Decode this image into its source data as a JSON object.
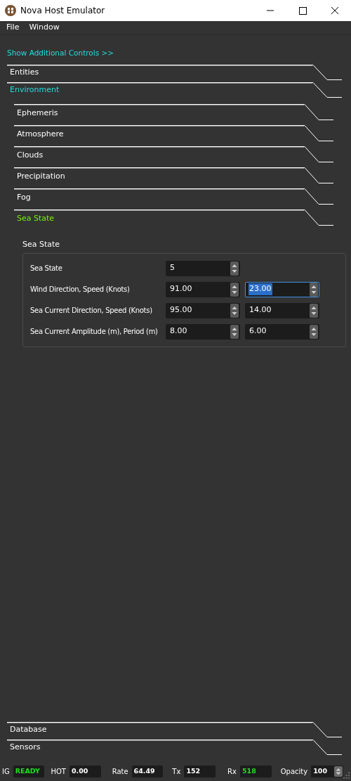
{
  "window": {
    "title": "Nova Host Emulator"
  },
  "menu": [
    "File",
    "Window"
  ],
  "link": "Show Additional Controls >>",
  "sections": [
    {
      "label": "Entities",
      "expanded": false
    },
    {
      "label": "Environment",
      "expanded": true,
      "children": [
        {
          "label": "Ephemeris",
          "expanded": false
        },
        {
          "label": "Atmosphere",
          "expanded": false
        },
        {
          "label": "Clouds",
          "expanded": false
        },
        {
          "label": "Precipitation",
          "expanded": false
        },
        {
          "label": "Fog",
          "expanded": false
        },
        {
          "label": "Sea State",
          "expanded": true,
          "group": {
            "title": "Sea State",
            "rows": [
              {
                "label": "Sea State",
                "fields": [
                  {
                    "value": "5",
                    "focused": false
                  }
                ]
              },
              {
                "label": "Wind Direction, Speed (Knots)",
                "fields": [
                  {
                    "value": "91.00",
                    "focused": false
                  },
                  {
                    "value": "23.00",
                    "focused": true
                  }
                ]
              },
              {
                "label": "Sea Current Direction, Speed (Knots)",
                "fields": [
                  {
                    "value": "95.00",
                    "focused": false
                  },
                  {
                    "value": "14.00",
                    "focused": false
                  }
                ]
              },
              {
                "label": "Sea Current Amplitude (m), Period (m)",
                "fields": [
                  {
                    "value": "8.00",
                    "focused": false
                  },
                  {
                    "value": "6.00",
                    "focused": false
                  }
                ]
              }
            ]
          }
        }
      ]
    }
  ],
  "bottom_sections": [
    {
      "label": "Database",
      "expanded": false
    },
    {
      "label": "Sensors",
      "expanded": false
    }
  ],
  "status_bar": [
    {
      "label": "IG",
      "value": "READY",
      "color": "#22dd22",
      "kind": "display"
    },
    {
      "label": "HOT",
      "value": "0.00",
      "color": "#ffffff",
      "kind": "display"
    },
    {
      "label": "Rate",
      "value": "64.49",
      "color": "#ffffff",
      "kind": "display"
    },
    {
      "label": "Tx",
      "value": "152",
      "color": "#ffffff",
      "kind": "display"
    },
    {
      "label": "Rx",
      "value": "518",
      "color": "#22dd22",
      "kind": "display"
    },
    {
      "label": "Opacity",
      "value": "100",
      "color": "#ffffff",
      "kind": "spin"
    }
  ]
}
